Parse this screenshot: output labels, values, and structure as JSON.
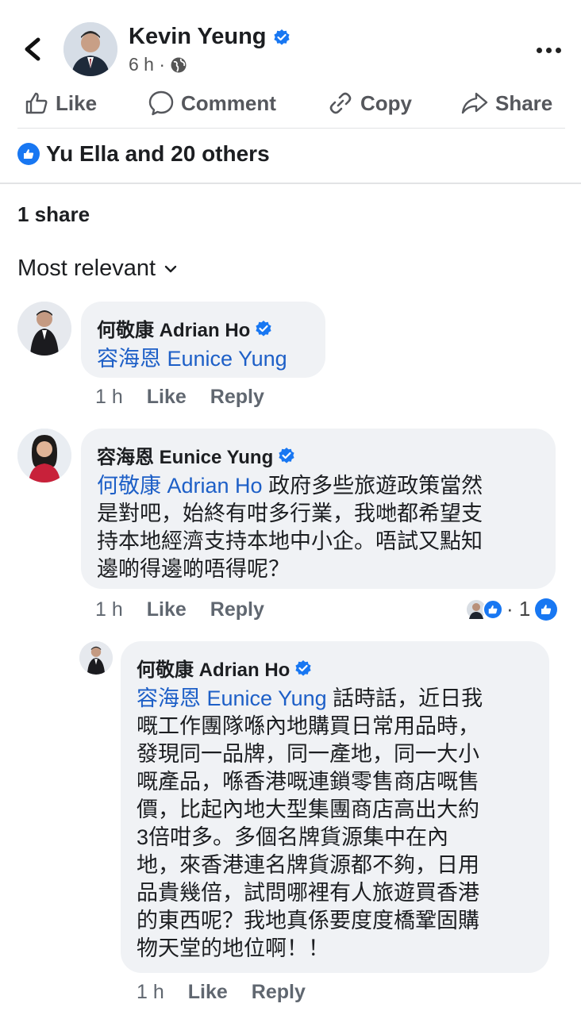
{
  "header": {
    "author": "Kevin Yeung",
    "time": "6 h ·"
  },
  "actions": {
    "like": "Like",
    "comment": "Comment",
    "copy": "Copy",
    "share": "Share"
  },
  "post_stats": {
    "reactions": "Yu Ella and 20 others",
    "shares": "1 share"
  },
  "sort": {
    "label": "Most relevant"
  },
  "comments": [
    {
      "author": "何敬康 Adrian Ho",
      "mention": "容海恩 Eunice Yung",
      "text": "",
      "time": "1 h",
      "like": "Like",
      "reply": "Reply"
    },
    {
      "author": "容海恩 Eunice Yung",
      "mention": "何敬康 Adrian Ho",
      "line1": " 政府多些旅遊政策當然",
      "line2": "是對吧，始終有咁多行業，我哋都希望支",
      "line3": "持本地經濟支持本地中小企。唔試又點知",
      "line4": "邊啲得邊啲唔得呢？",
      "time": "1 h",
      "like": "Like",
      "reply": "Reply",
      "reaction_count": "1"
    },
    {
      "author": "何敬康 Adrian Ho",
      "mention": "容海恩 Eunice Yung",
      "line1": " 話時話，近日我",
      "line2": "嘅工作團隊喺內地購買日常用品時，",
      "line3": "發現同一品牌，同一產地，同一大小",
      "line4": "嘅產品，喺香港嘅連鎖零售商店嘅售",
      "line5": "價，比起內地大型集團商店高出大約",
      "line6": "3倍咁多。多個名牌貨源集中在內",
      "line7": "地，來香港連名牌貨源都不夠，日用",
      "line8": "品貴幾倍，試問哪裡有人旅遊買香港",
      "line9": "的東西呢？我地真係要度度橋鞏固購",
      "line10": "物天堂的地位啊！！",
      "time": "1 h",
      "like": "Like",
      "reply": "Reply"
    }
  ],
  "colors": {
    "accent": "#1877f2",
    "mention": "#1d5fc7",
    "bubble": "#f0f2f5"
  }
}
